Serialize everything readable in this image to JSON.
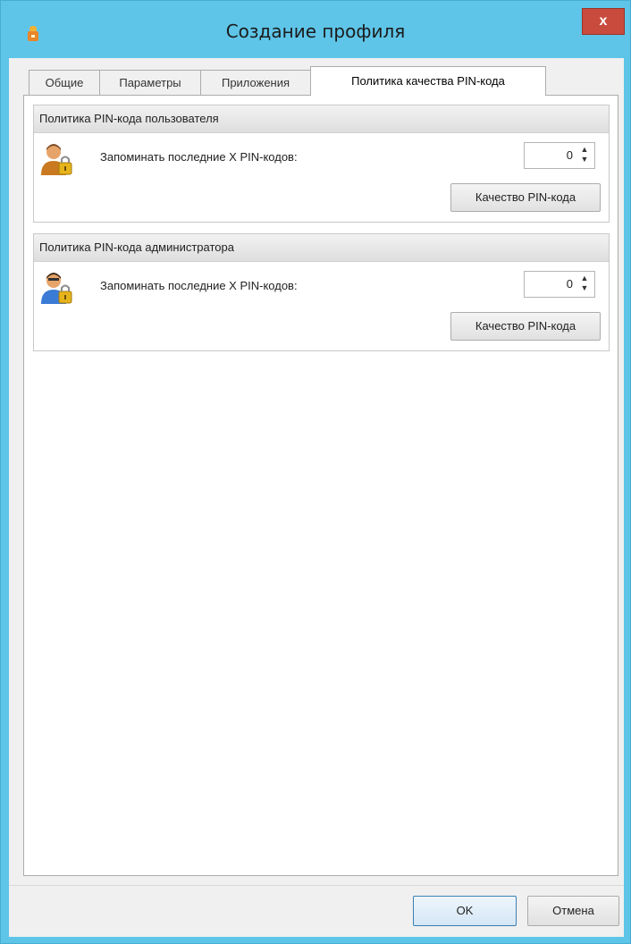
{
  "window": {
    "title": "Создание профиля",
    "close_label": "x"
  },
  "tabs": [
    {
      "label": "Общие",
      "active": false
    },
    {
      "label": "Параметры",
      "active": false
    },
    {
      "label": "Приложения",
      "active": false
    },
    {
      "label": "Политика качества PIN-кода",
      "active": true
    }
  ],
  "groups": [
    {
      "title": "Политика PIN-кода пользователя",
      "icon": "user-lock-icon",
      "remember_label": "Запоминать последние X PIN-кодов:",
      "remember_value": "0",
      "quality_button": "Качество PIN-кода"
    },
    {
      "title": "Политика PIN-кода администратора",
      "icon": "admin-lock-icon",
      "remember_label": "Запоминать последние X PIN-кодов:",
      "remember_value": "0",
      "quality_button": "Качество PIN-кода"
    }
  ],
  "footer": {
    "ok_label": "OK",
    "cancel_label": "Отмена"
  },
  "colors": {
    "titlebar": "#5ec5e8",
    "close": "#c84b3d"
  }
}
